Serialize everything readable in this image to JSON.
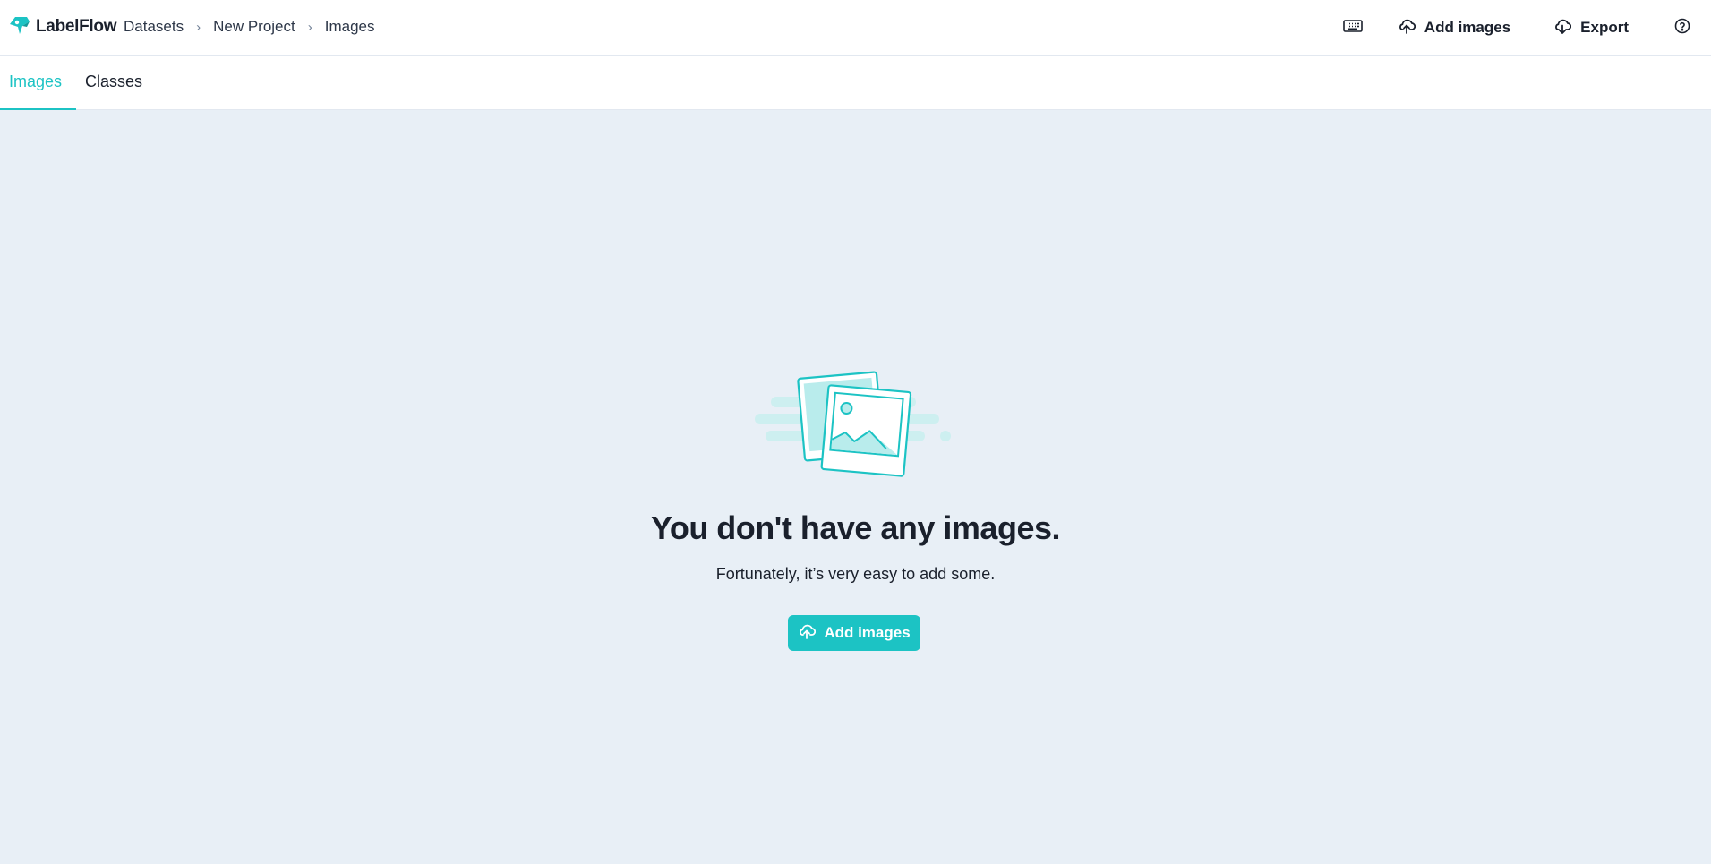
{
  "app": {
    "name": "LabelFlow",
    "brand_color": "#1cc3c4"
  },
  "breadcrumb": {
    "items": [
      {
        "label": "Datasets"
      },
      {
        "label": "New Project"
      },
      {
        "label": "Images"
      }
    ],
    "separator": "›"
  },
  "toolbar": {
    "keyboard_icon": "keyboard-icon",
    "add_images_label": "Add images",
    "export_label": "Export",
    "help_icon": "question-circle-icon"
  },
  "tabs": [
    {
      "label": "Images",
      "active": true
    },
    {
      "label": "Classes",
      "active": false
    }
  ],
  "empty_state": {
    "illustration": "photo-stack-illustration",
    "title": "You don't have any images.",
    "subtitle": "Fortunately, it’s very easy to add some.",
    "cta_label": "Add images",
    "cta_icon": "cloud-upload-icon"
  }
}
